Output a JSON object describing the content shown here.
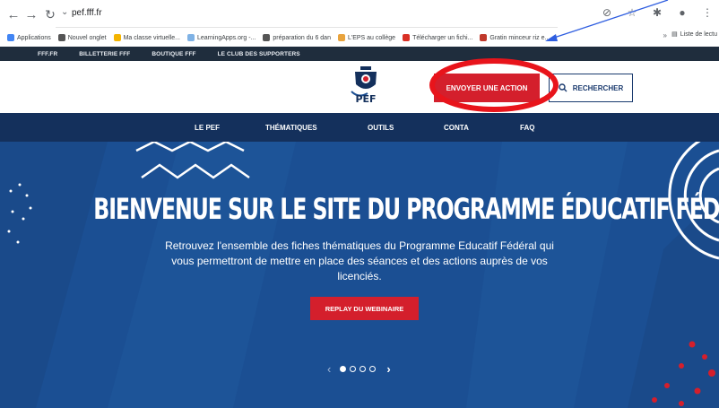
{
  "browser": {
    "url": "pef.fff.fr",
    "bookmarks": [
      {
        "label": "Applications",
        "icon": "apps-grid-icon",
        "color": "#4285f4"
      },
      {
        "label": "Nouvel onglet",
        "icon": "chrome-icon",
        "color": "#555555"
      },
      {
        "label": "Ma classe virtuelle...",
        "icon": "class-icon",
        "color": "#f4b400"
      },
      {
        "label": "LearningApps.org -...",
        "icon": "learningapps-icon",
        "color": "#7fb2e5"
      },
      {
        "label": "préparation du 6 dan",
        "icon": "chrome-icon",
        "color": "#555555"
      },
      {
        "label": "L'EPS au collège",
        "icon": "eps-icon",
        "color": "#e8a33d"
      },
      {
        "label": "Télécharger un fichi...",
        "icon": "download-site-icon",
        "color": "#d93025"
      },
      {
        "label": "Gratin minceur riz e...",
        "icon": "recipe-icon",
        "color": "#c0392b"
      }
    ],
    "more": "»",
    "reading_list": "Liste de lectu"
  },
  "site": {
    "topbar": [
      "FFF.FR",
      "BILLETTERIE FFF",
      "BOUTIQUE FFF",
      "LE CLUB DES SUPPORTERS"
    ],
    "cta_label": "ENVOYER UNE ACTION",
    "search_label": "RECHERCHER",
    "nav": [
      "LE PEF",
      "THÉMATIQUES",
      "OUTILS",
      "CONTA",
      "FAQ"
    ]
  },
  "hero": {
    "title": "BIENVENUE SUR LE SITE DU PROGRAMME ÉDUCATIF FÉDÉRAL",
    "text": "Retrouvez l'ensemble des fiches thématiques du Programme Educatif Fédéral qui vous permettront de mettre en place des séances et des actions auprès de vos licenciés.",
    "button": "REPLAY DU WEBINAIRE",
    "slides": 4,
    "active_slide": 1
  },
  "colors": {
    "accent_red": "#d41f2c",
    "nav_navy": "#14305c",
    "hero_blue": "#1b4f93",
    "annotation_red": "#e8141b",
    "annotation_arrow": "#2f5ee0"
  }
}
